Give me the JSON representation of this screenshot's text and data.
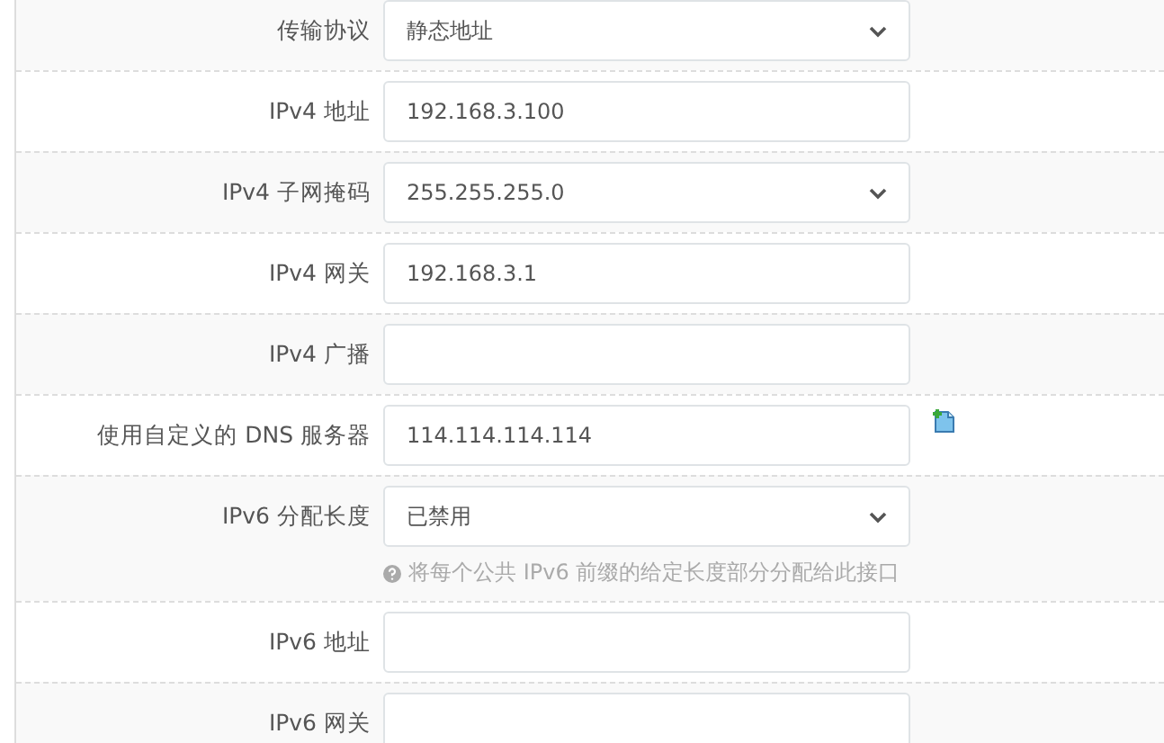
{
  "rows": [
    {
      "label": "传输协议",
      "kind": "select",
      "value": "静态地址"
    },
    {
      "label": "IPv4 地址",
      "kind": "text",
      "value": "192.168.3.100"
    },
    {
      "label": "IPv4 子网掩码",
      "kind": "select",
      "value": "255.255.255.0"
    },
    {
      "label": "IPv4 网关",
      "kind": "text",
      "value": "192.168.3.1"
    },
    {
      "label": "IPv4 广播",
      "kind": "text"
    },
    {
      "label": "使用自定义的 DNS 服务器",
      "kind": "text",
      "value": "114.114.114.114",
      "add_button": true
    },
    {
      "label": "IPv6 分配长度",
      "kind": "select",
      "value": "已禁用",
      "help": "将每个公共 IPv6 前缀的给定长度部分分配给此接口"
    },
    {
      "label": "IPv6 地址",
      "kind": "text"
    },
    {
      "label": "IPv6 网关",
      "kind": "text"
    }
  ]
}
